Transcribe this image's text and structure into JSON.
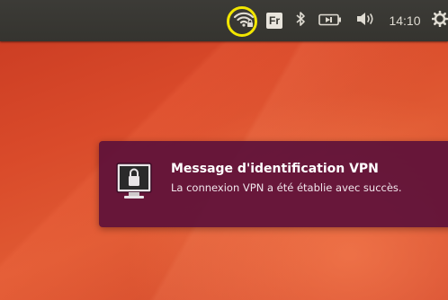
{
  "top_panel": {
    "indicators": [
      {
        "icon": "wifi-vpn-icon",
        "highlighted": true,
        "highlight_color": "#f2e600"
      },
      {
        "icon": "keyboard-layout-icon",
        "label": "Fr"
      },
      {
        "icon": "bluetooth-icon"
      },
      {
        "icon": "battery-icon"
      },
      {
        "icon": "volume-icon"
      },
      {
        "icon": "settings-gear-icon"
      }
    ],
    "keyboard_layout": "Fr",
    "clock": "14:10"
  },
  "notification": {
    "icon": "lock-screen-icon",
    "title": "Message d'identification VPN",
    "body": "La connexion VPN a été établie avec succès."
  },
  "colors": {
    "panel": "#3c3b37",
    "notification_bg": "#5c103a",
    "wallpaper": "#d94a2a",
    "highlight": "#f2e600"
  }
}
